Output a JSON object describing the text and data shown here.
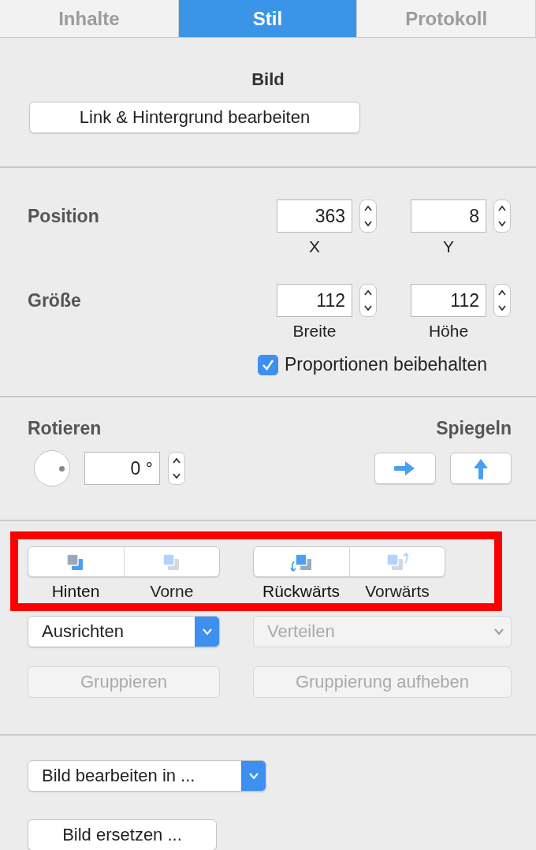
{
  "tabs": [
    {
      "label": "Inhalte",
      "selected": false
    },
    {
      "label": "Stil",
      "selected": true
    },
    {
      "label": "Protokoll",
      "selected": false
    }
  ],
  "image_section": {
    "title": "Bild",
    "button": "Link & Hintergrund bearbeiten"
  },
  "position": {
    "label": "Position",
    "fields": [
      {
        "value": "363",
        "caption": "X"
      },
      {
        "value": "8",
        "caption": "Y"
      }
    ]
  },
  "size": {
    "label": "Größe",
    "fields": [
      {
        "value": "112",
        "caption": "Breite"
      },
      {
        "value": "112",
        "caption": "Höhe"
      }
    ],
    "checkbox": {
      "label": "Proportionen beibehalten",
      "checked": true
    }
  },
  "rotate": {
    "label": "Rotieren",
    "value": "0 °"
  },
  "mirror": {
    "label": "Spiegeln",
    "buttons": [
      {
        "kind": "horizontal"
      },
      {
        "kind": "vertical"
      }
    ]
  },
  "arrange": {
    "highlighted": true,
    "groups": [
      [
        {
          "label": "Hinten",
          "kind": "back",
          "disabled": false
        },
        {
          "label": "Vorne",
          "kind": "front",
          "disabled": true
        }
      ],
      [
        {
          "label": "Rückwärts",
          "kind": "backward",
          "disabled": false
        },
        {
          "label": "Vorwärts",
          "kind": "forward",
          "disabled": true
        }
      ]
    ]
  },
  "align": {
    "label": "Ausrichten",
    "disabled": false
  },
  "distribute": {
    "label": "Verteilen",
    "disabled": true
  },
  "group_buttons": [
    {
      "label": "Gruppieren",
      "disabled": true
    },
    {
      "label": "Gruppierung aufheben",
      "disabled": true
    }
  ],
  "edit_in": {
    "label": "Bild bearbeiten in ...",
    "disabled": false
  },
  "replace_button": "Bild ersetzen ..."
}
